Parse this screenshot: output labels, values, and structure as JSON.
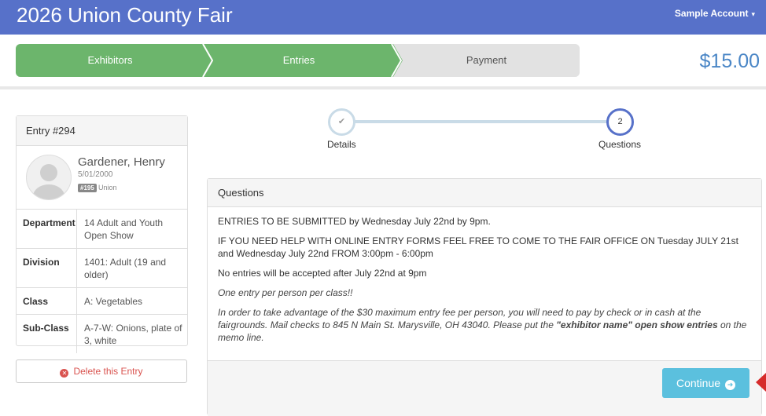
{
  "header": {
    "title": "2026 Union County Fair",
    "account_label": "Sample Account",
    "account_caret": "▾",
    "brand_color": "#5771c9"
  },
  "progress": {
    "steps": [
      {
        "label": "Exhibitors",
        "state": "done"
      },
      {
        "label": "Entries",
        "state": "active"
      },
      {
        "label": "Payment",
        "state": "pending"
      }
    ],
    "total": "$15.00"
  },
  "entry": {
    "title": "Entry #294",
    "person": {
      "name": "Gardener, Henry",
      "dob": "5/01/2000",
      "badge": "#195",
      "county": "Union"
    },
    "details": [
      {
        "label": "Department",
        "value": "14 Adult and Youth Open Show"
      },
      {
        "label": "Division",
        "value": "1401: Adult (19 and older)"
      },
      {
        "label": "Class",
        "value": "A: Vegetables"
      },
      {
        "label": "Sub-Class",
        "value": "A-7-W: Onions, plate of 3, white"
      }
    ],
    "delete_label": "Delete this Entry",
    "delete_icon": "times-circle-icon"
  },
  "wizard": {
    "steps": [
      {
        "label": "Details",
        "marker": "✔",
        "state": "done"
      },
      {
        "label": "Questions",
        "marker": "2",
        "state": "active"
      }
    ]
  },
  "questions": {
    "title": "Questions",
    "paragraphs": {
      "p1": "ENTRIES TO BE SUBMITTED by Wednesday July 22nd by 9pm.",
      "p2": "IF YOU NEED HELP WITH ONLINE ENTRY FORMS FEEL FREE TO COME TO THE FAIR OFFICE ON Tuesday JULY 21st and Wednesday July 22nd FROM 3:00pm - 6:00pm",
      "p3": "No entries will be accepted after July 22nd at 9pm",
      "p4": "One entry per person per class!!",
      "p5_a": "In order to take advantage of the $30 maximum entry fee per person, you will need to pay by check or in cash at the fairgrounds. Mail checks to 845 N Main St. Marysville, OH 43040. Please put the ",
      "p5_b": "\"exhibitor name\" open show entries",
      "p5_c": " on the memo line."
    },
    "continue_label": "Continue",
    "continue_icon": "arrow-circle-right-icon"
  }
}
